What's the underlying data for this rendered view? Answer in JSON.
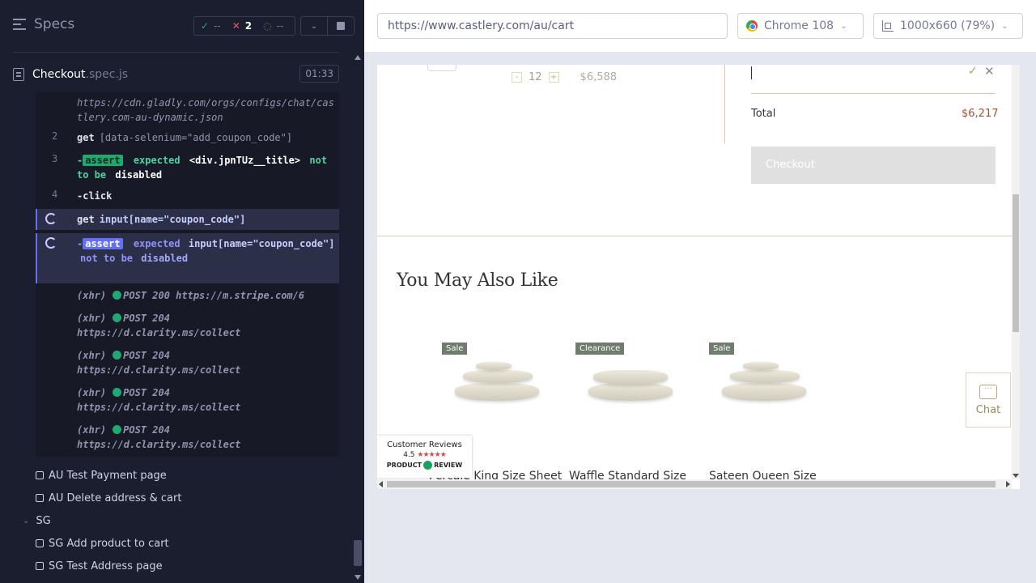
{
  "header": {
    "title": "Specs",
    "passed": "--",
    "failed": "2",
    "pending": "--"
  },
  "spec": {
    "name": "Checkout",
    "ext": ".spec.js",
    "time": "01:33"
  },
  "commands": [
    {
      "url": "https://cdn.gladly.com/orgs/configs/chat/castlery.com-au-dynamic.json"
    },
    {
      "num": "2",
      "kw": "get",
      "sel": "[data-selenium=\"add_coupon_code\"]"
    },
    {
      "num": "3",
      "prefix": "-",
      "badge": "assert",
      "t1": "expected",
      "t2": "<div.jpnTUz__title>",
      "t3": "not to be",
      "t4": "disabled"
    },
    {
      "num": "4",
      "prefix": "-",
      "kw": "click"
    },
    {
      "kw": "get",
      "sel": "input[name=\"coupon_code\"]"
    },
    {
      "prefix": "-",
      "badge": "assert",
      "t1": "expected",
      "t2": "input[name=\"coupon_code\"]",
      "t3": "not to be",
      "t4": "disabled"
    },
    {
      "tag": "(xhr)",
      "req": "POST 200 https://m.stripe.com/6"
    },
    {
      "tag": "(xhr)",
      "req": "POST 204",
      "url": "https://d.clarity.ms/collect"
    },
    {
      "tag": "(xhr)",
      "req": "POST 204",
      "url": "https://d.clarity.ms/collect"
    },
    {
      "tag": "(xhr)",
      "req": "POST 204",
      "url": "https://d.clarity.ms/collect"
    },
    {
      "tag": "(xhr)",
      "req": "POST 204",
      "url": "https://d.clarity.ms/collect"
    }
  ],
  "tests": {
    "au_payment": "AU Test Payment page",
    "au_delete": "AU Delete address & cart",
    "sg_suite": "SG",
    "sg_add": "SG Add product to cart",
    "sg_address": "SG Test Address page"
  },
  "toolbar": {
    "url": "https://www.castlery.com/au/cart",
    "browser": "Chrome 108",
    "viewport": "1000x660 (79%)"
  },
  "aut": {
    "qty": "12",
    "qty_minus": "-",
    "qty_plus": "+",
    "line_price": "$6,588",
    "total_label": "Total",
    "total_value": "$6,217",
    "checkout_label": "Checkout",
    "ymal_title": "You May Also Like",
    "products": [
      {
        "badge": "Sale",
        "name": "Percale King Size Sheet"
      },
      {
        "badge": "Clearance",
        "name": "Waffle Standard Size"
      },
      {
        "badge": "Sale",
        "name": "Sateen Queen Size"
      }
    ],
    "reviews": {
      "title": "Customer Reviews",
      "rating": "4.5",
      "stars": "★★★★★",
      "brand_left": "PRODUCT",
      "brand_right": "REVIEW"
    },
    "chat_label": "Chat"
  },
  "colors": {
    "pass": "#1fa971",
    "fail": "#e45770",
    "accent": "#6470f3",
    "price": "#a0522d"
  }
}
